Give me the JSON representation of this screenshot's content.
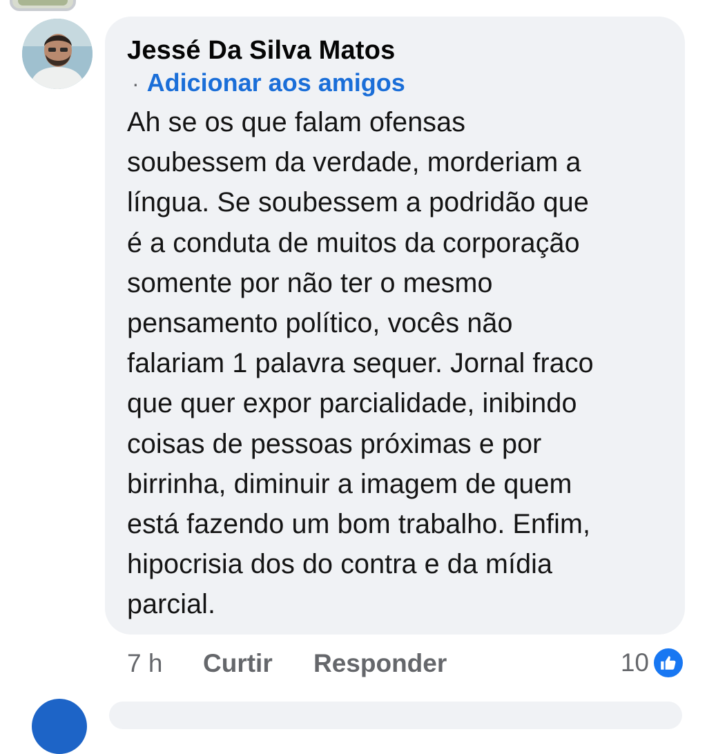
{
  "comment": {
    "author": "Jessé Da Silva Matos",
    "separator": "·",
    "add_friend_label": "Adicionar aos amigos",
    "text": "Ah se os que falam ofensas\nsoubessem da verdade, morderiam a\nlíngua. Se soubessem a podridão que\né a conduta de muitos da corporação\nsomente por não ter o mesmo\npensamento político, vocês não\nfalariam 1 palavra sequer. Jornal fraco\nque quer expor parcialidade, inibindo\ncoisas de pessoas próximas e por\nbirrinha, diminuir a imagem de quem\nestá fazendo um bom trabalho. Enfim,\nhipocrisia dos do contra e da mídia\nparcial.",
    "timestamp": "7 h",
    "like_label": "Curtir",
    "reply_label": "Responder",
    "reaction_count": "10",
    "reaction_icon": "thumbs-up-icon"
  },
  "colors": {
    "bubble_bg": "#f0f2f5",
    "link": "#1a6ed8",
    "muted": "#65676b",
    "like_blue": "#1877f2"
  }
}
